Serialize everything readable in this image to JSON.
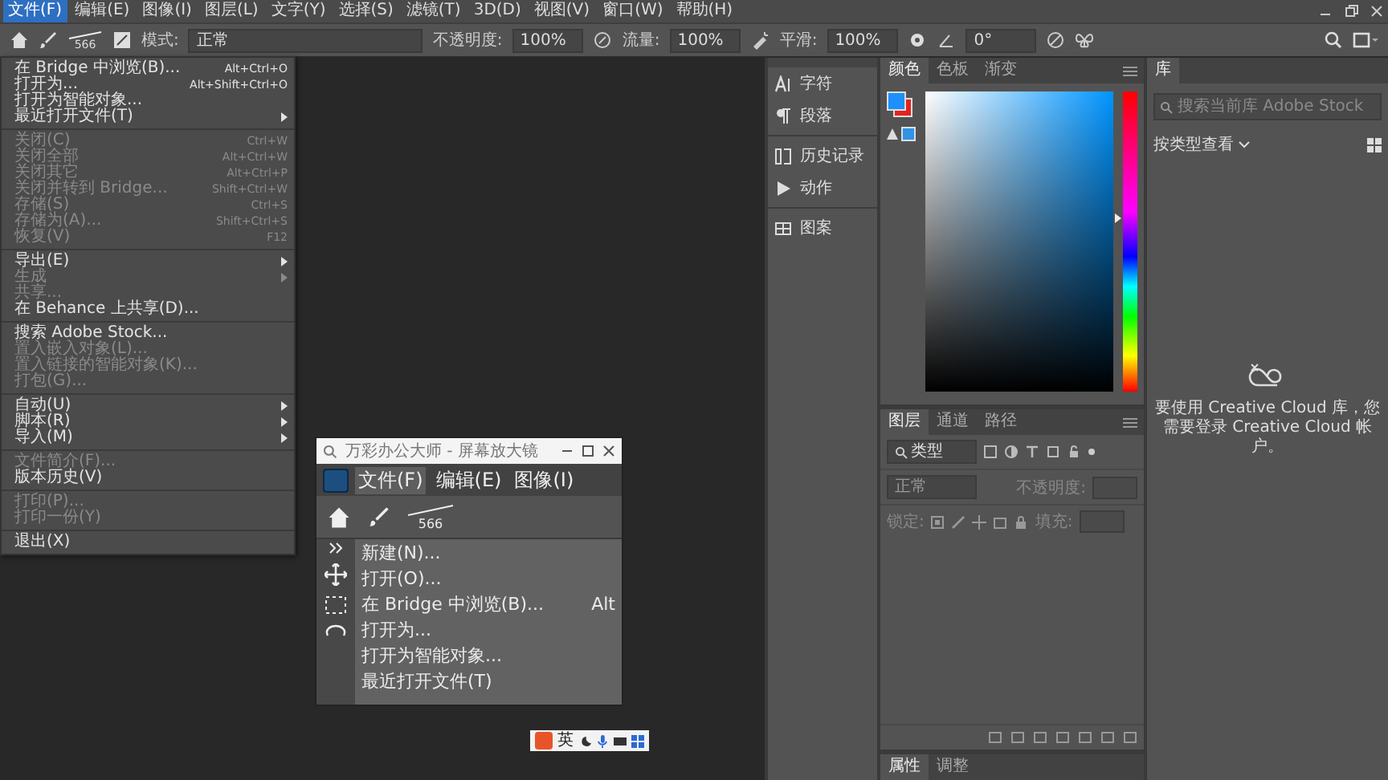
{
  "menu_bar": [
    {
      "label": "文件(F)",
      "selected": true
    },
    {
      "label": "编辑(E)",
      "selected": false
    },
    {
      "label": "图像(I)",
      "selected": false
    },
    {
      "label": "图层(L)",
      "selected": false
    },
    {
      "label": "文字(Y)",
      "selected": false
    },
    {
      "label": "选择(S)",
      "selected": false
    },
    {
      "label": "滤镜(T)",
      "selected": false
    },
    {
      "label": "3D(D)",
      "selected": false
    },
    {
      "label": "视图(V)",
      "selected": false
    },
    {
      "label": "窗口(W)",
      "selected": false
    },
    {
      "label": "帮助(H)",
      "selected": false
    }
  ],
  "options_bar": {
    "brush_size": "566",
    "mode_label": "模式:",
    "mode": "正常",
    "opacity_label": "不透明度:",
    "opacity": "100%",
    "flow_label": "流量:",
    "flow": "100%",
    "smoothing_label": "平滑:",
    "smoothing": "100%",
    "angle": "0°"
  },
  "file_menu": [
    {
      "kind": "item",
      "label": "在 Bridge 中浏览(B)...",
      "shortcut": "Alt+Ctrl+O",
      "disabled": false,
      "submenu": false
    },
    {
      "kind": "item",
      "label": "打开为...",
      "shortcut": "Alt+Shift+Ctrl+O",
      "disabled": false,
      "submenu": false
    },
    {
      "kind": "item",
      "label": "打开为智能对象...",
      "disabled": false,
      "submenu": false
    },
    {
      "kind": "item",
      "label": "最近打开文件(T)",
      "disabled": false,
      "submenu": true
    },
    {
      "kind": "separator"
    },
    {
      "kind": "item",
      "label": "关闭(C)",
      "shortcut": "Ctrl+W",
      "disabled": true,
      "submenu": false
    },
    {
      "kind": "item",
      "label": "关闭全部",
      "shortcut": "Alt+Ctrl+W",
      "disabled": true,
      "submenu": false
    },
    {
      "kind": "item",
      "label": "关闭其它",
      "shortcut": "Alt+Ctrl+P",
      "disabled": true,
      "submenu": false
    },
    {
      "kind": "item",
      "label": "关闭并转到 Bridge...",
      "shortcut": "Shift+Ctrl+W",
      "disabled": true,
      "submenu": false
    },
    {
      "kind": "item",
      "label": "存储(S)",
      "shortcut": "Ctrl+S",
      "disabled": true,
      "submenu": false
    },
    {
      "kind": "item",
      "label": "存储为(A)...",
      "shortcut": "Shift+Ctrl+S",
      "disabled": true,
      "submenu": false
    },
    {
      "kind": "item",
      "label": "恢复(V)",
      "shortcut": "F12",
      "disabled": true,
      "submenu": false
    },
    {
      "kind": "separator"
    },
    {
      "kind": "item",
      "label": "导出(E)",
      "disabled": false,
      "submenu": true
    },
    {
      "kind": "item",
      "label": "生成",
      "disabled": true,
      "submenu": true
    },
    {
      "kind": "item",
      "label": "共享...",
      "disabled": true,
      "submenu": false
    },
    {
      "kind": "item",
      "label": "在 Behance 上共享(D)...",
      "disabled": false,
      "submenu": false
    },
    {
      "kind": "separator"
    },
    {
      "kind": "item",
      "label": "搜索 Adobe Stock...",
      "disabled": false,
      "submenu": false
    },
    {
      "kind": "item",
      "label": "置入嵌入对象(L)...",
      "disabled": true,
      "submenu": false
    },
    {
      "kind": "item",
      "label": "置入链接的智能对象(K)...",
      "disabled": true,
      "submenu": false
    },
    {
      "kind": "item",
      "label": "打包(G)...",
      "disabled": true,
      "submenu": false
    },
    {
      "kind": "separator"
    },
    {
      "kind": "item",
      "label": "自动(U)",
      "disabled": false,
      "submenu": true
    },
    {
      "kind": "item",
      "label": "脚本(R)",
      "disabled": false,
      "submenu": true
    },
    {
      "kind": "item",
      "label": "导入(M)",
      "disabled": false,
      "submenu": true
    },
    {
      "kind": "separator"
    },
    {
      "kind": "item",
      "label": "文件简介(F)...",
      "disabled": true,
      "submenu": false
    },
    {
      "kind": "item",
      "label": "版本历史(V)",
      "disabled": false,
      "submenu": false
    },
    {
      "kind": "separator"
    },
    {
      "kind": "item",
      "label": "打印(P)...",
      "disabled": true,
      "submenu": false
    },
    {
      "kind": "item",
      "label": "打印一份(Y)",
      "disabled": true,
      "submenu": false
    },
    {
      "kind": "separator"
    },
    {
      "kind": "item",
      "label": "退出(X)",
      "disabled": false,
      "submenu": false
    }
  ],
  "side_panels": [
    {
      "kind": "character",
      "label": "字符"
    },
    {
      "kind": "paragraph",
      "label": "段落"
    },
    {
      "kind": "history",
      "label": "历史记录"
    },
    {
      "kind": "actions",
      "label": "动作"
    },
    {
      "kind": "patterns",
      "label": "图案"
    }
  ],
  "color_panel": {
    "hue": {
      "level": 0.58
    },
    "tabs": [
      {
        "label": "颜色",
        "selected": true
      },
      {
        "label": "色板",
        "selected": false
      },
      {
        "label": "渐变",
        "selected": false
      }
    ]
  },
  "layers_panel": {
    "tabs": [
      {
        "label": "图层",
        "selected": true
      },
      {
        "label": "通道",
        "selected": false
      },
      {
        "label": "路径",
        "selected": false
      }
    ],
    "filter": "类型",
    "blend_mode": "正常",
    "opacity_label": "不透明度:",
    "lock_label": "锁定:",
    "fill_label": "填充:"
  },
  "bottom_tabs": [
    {
      "label": "属性",
      "selected": true
    },
    {
      "label": "调整",
      "selected": false
    }
  ],
  "library_panel": {
    "tab": "库",
    "search_placeholder": "搜索当前库 Adobe Stock",
    "view": "按类型查看",
    "message": "要使用 Creative Cloud 库，您需要登录 Creative Cloud 帐户。"
  },
  "magnifier": {
    "title": "万彩办公大师 - 屏幕放大镜",
    "menu": [
      {
        "label": "文件(F)",
        "selected": true
      },
      {
        "label": "编辑(E)",
        "selected": false
      },
      {
        "label": "图像(I)",
        "selected": false
      }
    ],
    "brush_size": "566",
    "items": [
      {
        "label": "新建(N)..."
      },
      {
        "label": "打开(O)..."
      },
      {
        "label": "在 Bridge 中浏览(B)...",
        "shortcut": "Alt"
      },
      {
        "label": "打开为..."
      },
      {
        "label": "打开为智能对象..."
      },
      {
        "label": "最近打开文件(T)"
      }
    ]
  },
  "ime_bar": {
    "mode": "英"
  }
}
